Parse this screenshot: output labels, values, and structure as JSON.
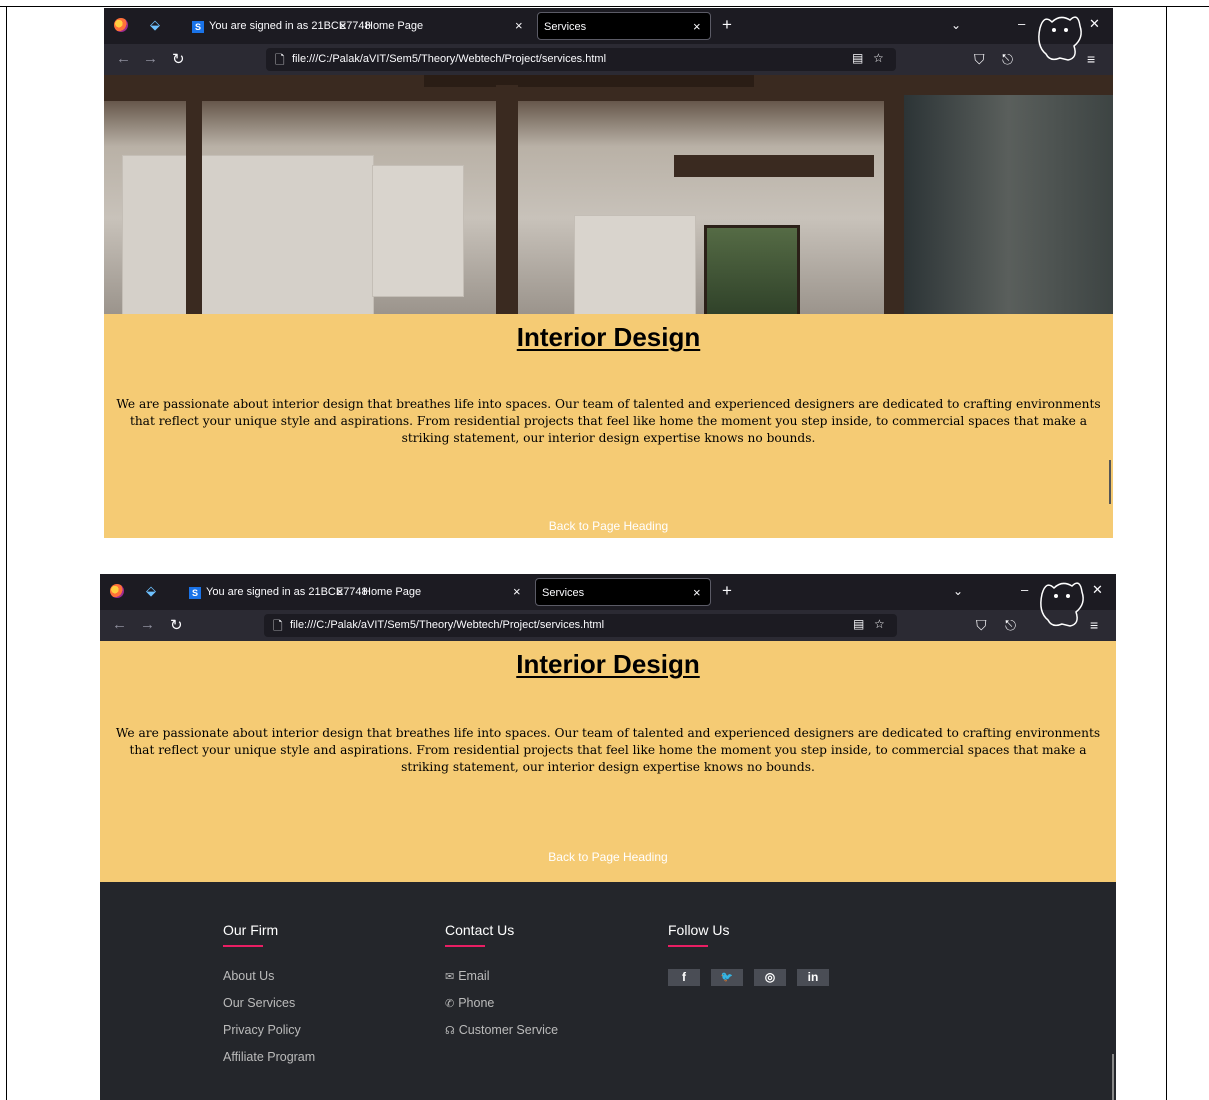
{
  "browser": {
    "tabs": [
      {
        "label": "You are signed in as 21BCE7748"
      },
      {
        "label": "Home Page"
      },
      {
        "label": "Services"
      }
    ],
    "url": "file:///C:/Palak/aVIT/Sem5/Theory/Webtech/Project/services.html",
    "close_glyph": "×",
    "new_tab_glyph": "+"
  },
  "section": {
    "heading": "Interior Design",
    "body": "We are passionate about interior design that breathes life into spaces. Our team of talented and experienced designers are dedicated to crafting environments that reflect your unique style and aspirations. From residential projects that feel like home the moment you step inside, to commercial spaces that make a striking statement, our interior design expertise knows no bounds.",
    "back_link": "Back to Page Heading"
  },
  "footer": {
    "firm": {
      "title": "Our Firm",
      "links": [
        "About Us",
        "Our Services",
        "Privacy Policy",
        "Affiliate Program"
      ]
    },
    "contact": {
      "title": "Contact Us",
      "links": [
        {
          "icon": "envelope-icon",
          "label": "Email"
        },
        {
          "icon": "phone-icon",
          "label": "Phone"
        },
        {
          "icon": "headset-icon",
          "label": "Customer Service"
        }
      ]
    },
    "follow": {
      "title": "Follow Us",
      "social": [
        {
          "icon": "facebook-icon",
          "glyph": "f"
        },
        {
          "icon": "twitter-icon",
          "glyph": "🐦"
        },
        {
          "icon": "instagram-icon",
          "glyph": "◎"
        },
        {
          "icon": "linkedin-icon",
          "glyph": "in"
        }
      ]
    }
  },
  "colors": {
    "section_bg": "#f5cb74",
    "footer_bg": "#24262b",
    "accent": "#e91e63",
    "browser_bg": "#1c1b22"
  }
}
